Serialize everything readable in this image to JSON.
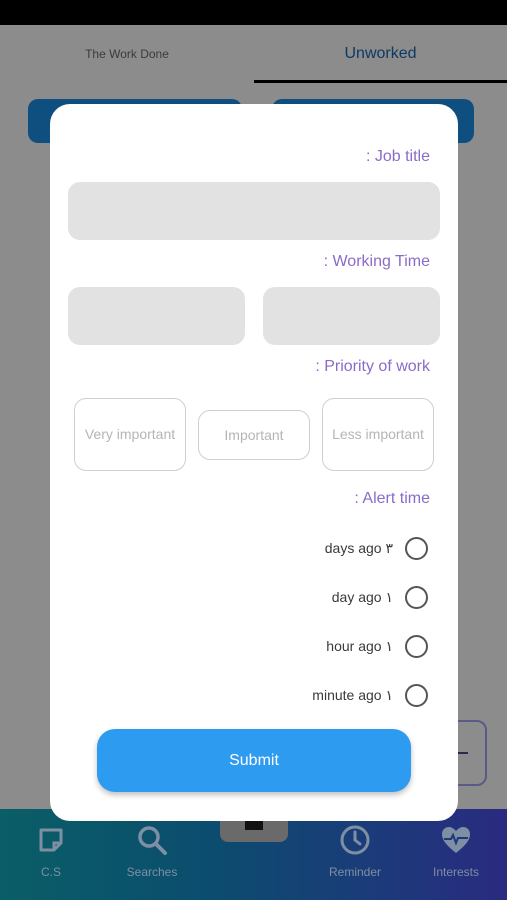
{
  "tabs": {
    "done": "The Work Done",
    "unworked": "Unworked"
  },
  "modal": {
    "job_title_label": ": Job title",
    "job_title_value": "",
    "working_time_label": ": Working Time",
    "working_time_start": "",
    "working_time_end": "",
    "priority_label": ": Priority of work",
    "priority_options": {
      "very": "Very important",
      "important": "Important",
      "less": "Less important"
    },
    "alert_label": ": Alert time",
    "alert_options": [
      "days ago ٣",
      "day ago ١",
      "hour ago ١",
      "minute ago ١"
    ],
    "submit_label": "Submit"
  },
  "bottom_nav": {
    "items": [
      {
        "label": "C.S",
        "icon": "note-icon"
      },
      {
        "label": "Searches",
        "icon": "search-icon"
      },
      {
        "label": "Reminder",
        "icon": "clock-icon"
      },
      {
        "label": "Interests",
        "icon": "heart-pulse-icon"
      }
    ]
  },
  "colors": {
    "accent": "#2d9bf0",
    "label_purple": "#8b6bc8",
    "input_gray": "#e2e2e2"
  }
}
